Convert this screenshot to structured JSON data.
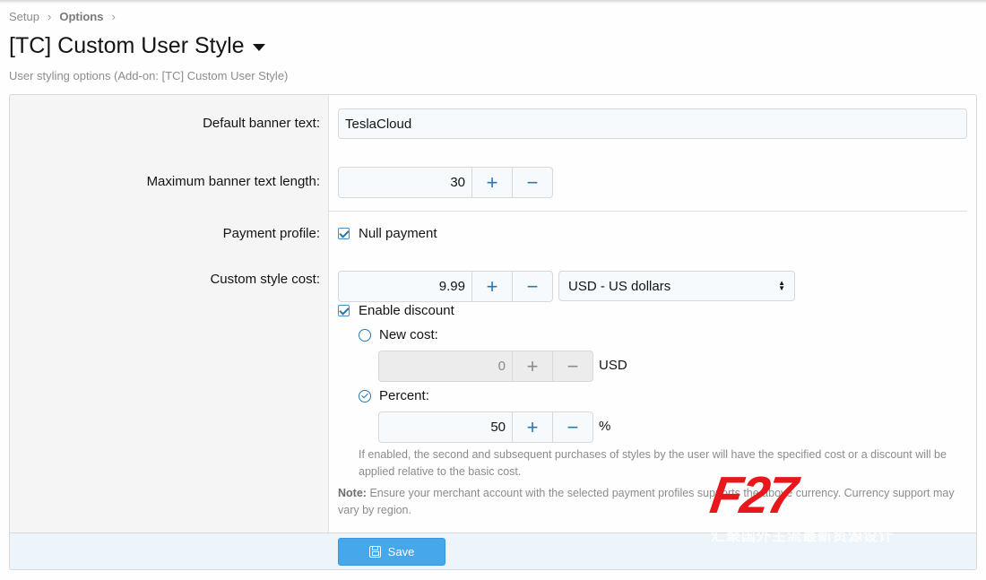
{
  "breadcrumb": {
    "items": [
      "Setup",
      "Options"
    ]
  },
  "page": {
    "title": "[TC] Custom User Style",
    "description": "User styling options (Add-on: [TC] Custom User Style)"
  },
  "form": {
    "default_banner": {
      "label": "Default banner text:",
      "value": "TeslaCloud"
    },
    "max_banner_length": {
      "label": "Maximum banner text length:",
      "value": "30"
    },
    "payment_profile": {
      "label": "Payment profile:",
      "option": "Null payment",
      "checked": true
    },
    "custom_style_cost": {
      "label": "Custom style cost:",
      "value": "9.99",
      "currency": "USD - US dollars"
    },
    "enable_discount": {
      "label": "Enable discount",
      "checked": true
    },
    "new_cost": {
      "label": "New cost:",
      "value": "0",
      "unit": "USD",
      "selected": false
    },
    "percent": {
      "label": "Percent:",
      "value": "50",
      "unit": "%",
      "selected": true
    },
    "explain_discount": "If enabled, the second and subsequent purchases of styles by the user will have the specified cost or a discount will be applied relative to the basic cost.",
    "note_prefix": "Note:",
    "note_text": "Ensure your merchant account with the selected payment profiles supports the above currency. Currency support may vary by region."
  },
  "stepper": {
    "plus": "+",
    "minus": "−"
  },
  "actions": {
    "save_label": "Save"
  },
  "watermark": {
    "logo": "F27",
    "tagline": "汇聚国外主流最新资源设计"
  },
  "colors": {
    "accent": "#2577b1",
    "button": "#47a7eb",
    "watermark_red": "#e8171c"
  }
}
